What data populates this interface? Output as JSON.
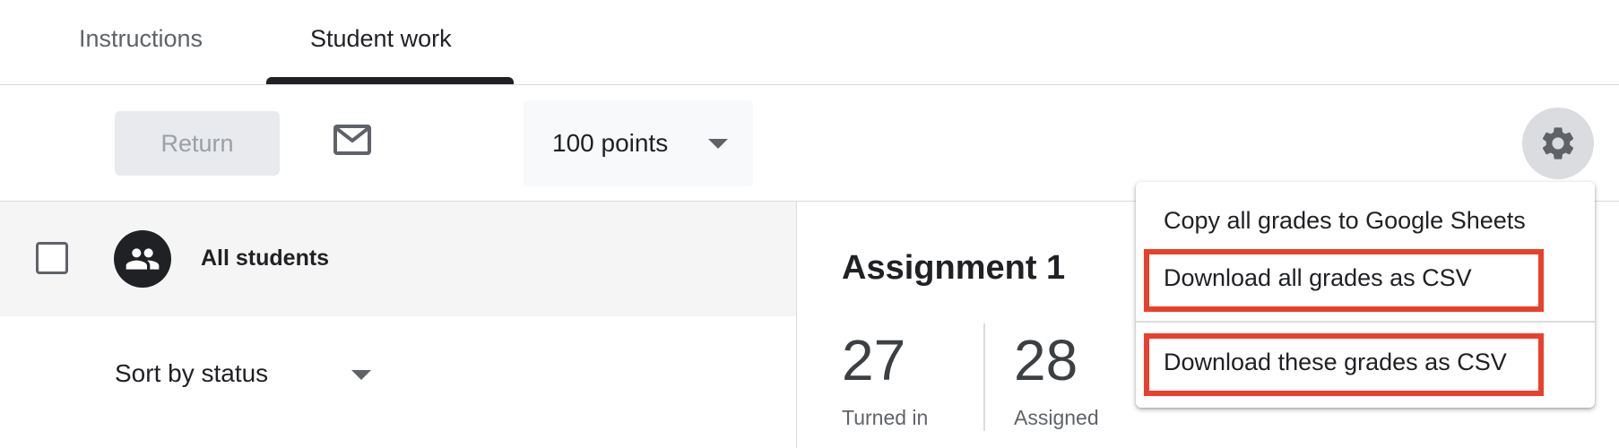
{
  "tabs": {
    "instructions": "Instructions",
    "student_work": "Student work"
  },
  "toolbar": {
    "return_label": "Return",
    "points_value": "100 points"
  },
  "students": {
    "all_label": "All students",
    "sort_label": "Sort by status"
  },
  "assignment": {
    "title": "Assignment 1",
    "turned_in_count": "27",
    "turned_in_label": "Turned in",
    "assigned_count": "28",
    "assigned_label": "Assigned"
  },
  "settings_menu": {
    "items": [
      "Copy all grades to Google Sheets",
      "Download all grades as CSV",
      "Download these grades as CSV"
    ]
  },
  "icons": {
    "mail": "mail-icon",
    "gear": "gear-icon",
    "group": "group-icon",
    "caret": "caret-down-icon"
  },
  "colors": {
    "highlight": "#e8402c",
    "tab_active": "#202124"
  }
}
